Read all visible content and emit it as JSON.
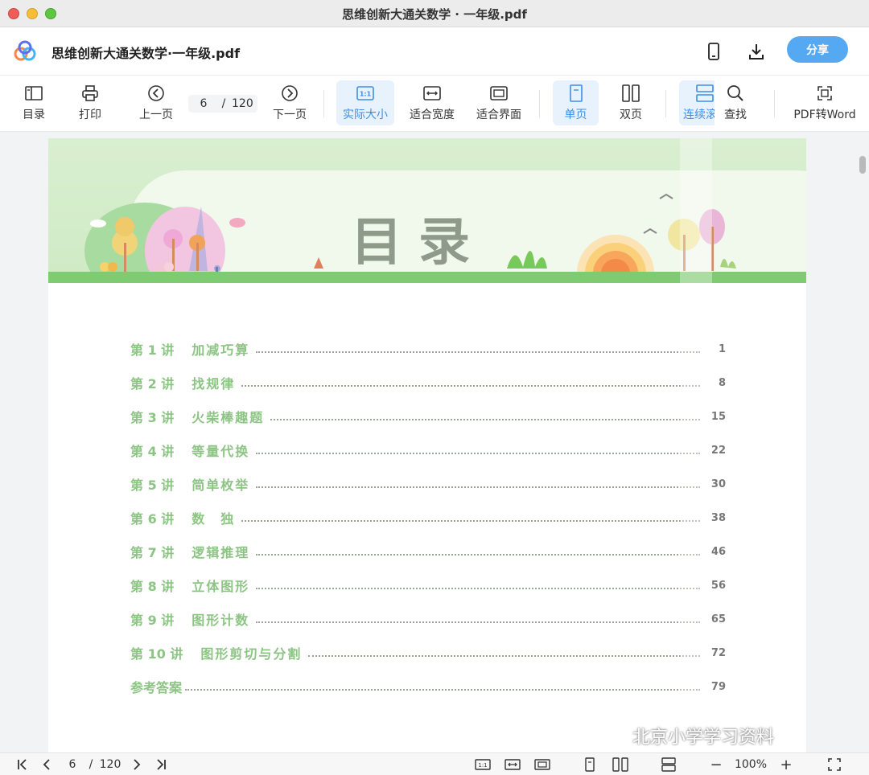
{
  "window": {
    "title": "思维创新大通关数学 · 一年级.pdf"
  },
  "header": {
    "doc_title": "思维创新大通关数学·一年级.pdf",
    "share_label": "分享",
    "icons": [
      "logo-icon",
      "phone-icon",
      "download-icon"
    ]
  },
  "toolbar": {
    "toc_label": "目录",
    "print_label": "打印",
    "prev_label": "上一页",
    "page_current": "6",
    "page_separator": "/",
    "page_total": "120",
    "next_label": "下一页",
    "actual_size_label": "实际大小",
    "fit_width_label": "适合宽度",
    "fit_page_label": "适合界面",
    "single_page_label": "单页",
    "double_page_label": "双页",
    "continuous_label": "连续滚",
    "find_label": "查找",
    "pdf_to_word_label": "PDF转Word",
    "active_color": "#3d8ee8"
  },
  "document": {
    "banner_title": "目录",
    "toc": [
      {
        "lecture": "第 1 讲",
        "topic": "加减巧算",
        "page": "1"
      },
      {
        "lecture": "第 2 讲",
        "topic": "找规律",
        "page": "8"
      },
      {
        "lecture": "第 3 讲",
        "topic": "火柴棒趣题",
        "page": "15"
      },
      {
        "lecture": "第 4 讲",
        "topic": "等量代换",
        "page": "22"
      },
      {
        "lecture": "第 5 讲",
        "topic": "简单枚举",
        "page": "30"
      },
      {
        "lecture": "第 6 讲",
        "topic": "数　独",
        "page": "38"
      },
      {
        "lecture": "第 7 讲",
        "topic": "逻辑推理",
        "page": "46"
      },
      {
        "lecture": "第 8 讲",
        "topic": "立体图形",
        "page": "56"
      },
      {
        "lecture": "第 9 讲",
        "topic": "图形计数",
        "page": "65"
      },
      {
        "lecture": "第 10 讲",
        "topic": "图形剪切与分割",
        "page": "72"
      },
      {
        "lecture": "参考答案",
        "topic": "",
        "page": "79"
      }
    ],
    "toc_color": "#8cc583"
  },
  "watermark": "北京小学学习资料",
  "statusbar": {
    "page_current": "6",
    "page_separator": "/",
    "page_total": "120",
    "zoom": "100%",
    "zoom_minus": "−",
    "zoom_plus": "+"
  }
}
